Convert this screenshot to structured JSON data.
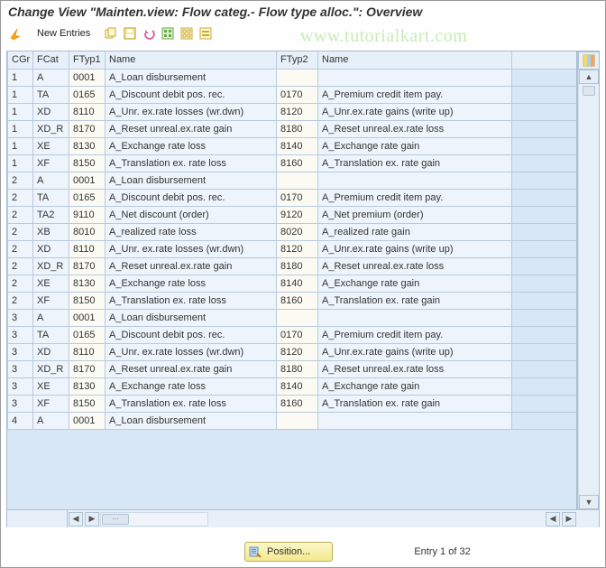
{
  "title": "Change View \"Mainten.view: Flow categ.- Flow type alloc.\": Overview",
  "watermark": "www.tutorialkart.com",
  "toolbar": {
    "new_entries": "New Entries"
  },
  "columns": {
    "cgr": "CGr",
    "fcat": "FCat",
    "ftyp1": "FTyp1",
    "name1": "Name",
    "ftyp2": "FTyp2",
    "name2": "Name"
  },
  "rows": [
    {
      "cgr": "1",
      "fcat": "A",
      "ftyp1": "0001",
      "name1": "A_Loan disbursement",
      "ftyp2": "",
      "name2": ""
    },
    {
      "cgr": "1",
      "fcat": "TA",
      "ftyp1": "0165",
      "name1": "A_Discount debit pos. rec.",
      "ftyp2": "0170",
      "name2": "A_Premium credit item pay."
    },
    {
      "cgr": "1",
      "fcat": "XD",
      "ftyp1": "8110",
      "name1": "A_Unr. ex.rate losses (wr.dwn)",
      "ftyp2": "8120",
      "name2": "A_Unr.ex.rate gains (write up)"
    },
    {
      "cgr": "1",
      "fcat": "XD_R",
      "ftyp1": "8170",
      "name1": "A_Reset unreal.ex.rate gain",
      "ftyp2": "8180",
      "name2": "A_Reset unreal.ex.rate loss"
    },
    {
      "cgr": "1",
      "fcat": "XE",
      "ftyp1": "8130",
      "name1": "A_Exchange rate loss",
      "ftyp2": "8140",
      "name2": "A_Exchange rate gain"
    },
    {
      "cgr": "1",
      "fcat": "XF",
      "ftyp1": "8150",
      "name1": "A_Translation ex. rate loss",
      "ftyp2": "8160",
      "name2": "A_Translation ex. rate gain"
    },
    {
      "cgr": "2",
      "fcat": "A",
      "ftyp1": "0001",
      "name1": "A_Loan disbursement",
      "ftyp2": "",
      "name2": ""
    },
    {
      "cgr": "2",
      "fcat": "TA",
      "ftyp1": "0165",
      "name1": "A_Discount debit pos. rec.",
      "ftyp2": "0170",
      "name2": "A_Premium credit item pay."
    },
    {
      "cgr": "2",
      "fcat": "TA2",
      "ftyp1": "9110",
      "name1": "A_Net discount (order)",
      "ftyp2": "9120",
      "name2": "A_Net premium (order)"
    },
    {
      "cgr": "2",
      "fcat": "XB",
      "ftyp1": "8010",
      "name1": "A_realized rate loss",
      "ftyp2": "8020",
      "name2": "A_realized rate gain"
    },
    {
      "cgr": "2",
      "fcat": "XD",
      "ftyp1": "8110",
      "name1": "A_Unr. ex.rate losses (wr.dwn)",
      "ftyp2": "8120",
      "name2": "A_Unr.ex.rate gains (write up)"
    },
    {
      "cgr": "2",
      "fcat": "XD_R",
      "ftyp1": "8170",
      "name1": "A_Reset unreal.ex.rate gain",
      "ftyp2": "8180",
      "name2": "A_Reset unreal.ex.rate loss"
    },
    {
      "cgr": "2",
      "fcat": "XE",
      "ftyp1": "8130",
      "name1": "A_Exchange rate loss",
      "ftyp2": "8140",
      "name2": "A_Exchange rate gain"
    },
    {
      "cgr": "2",
      "fcat": "XF",
      "ftyp1": "8150",
      "name1": "A_Translation ex. rate loss",
      "ftyp2": "8160",
      "name2": "A_Translation ex. rate gain"
    },
    {
      "cgr": "3",
      "fcat": "A",
      "ftyp1": "0001",
      "name1": "A_Loan disbursement",
      "ftyp2": "",
      "name2": ""
    },
    {
      "cgr": "3",
      "fcat": "TA",
      "ftyp1": "0165",
      "name1": "A_Discount debit pos. rec.",
      "ftyp2": "0170",
      "name2": "A_Premium credit item pay."
    },
    {
      "cgr": "3",
      "fcat": "XD",
      "ftyp1": "8110",
      "name1": "A_Unr. ex.rate losses (wr.dwn)",
      "ftyp2": "8120",
      "name2": "A_Unr.ex.rate gains (write up)"
    },
    {
      "cgr": "3",
      "fcat": "XD_R",
      "ftyp1": "8170",
      "name1": "A_Reset unreal.ex.rate gain",
      "ftyp2": "8180",
      "name2": "A_Reset unreal.ex.rate loss"
    },
    {
      "cgr": "3",
      "fcat": "XE",
      "ftyp1": "8130",
      "name1": "A_Exchange rate loss",
      "ftyp2": "8140",
      "name2": "A_Exchange rate gain"
    },
    {
      "cgr": "3",
      "fcat": "XF",
      "ftyp1": "8150",
      "name1": "A_Translation ex. rate loss",
      "ftyp2": "8160",
      "name2": "A_Translation ex. rate gain"
    },
    {
      "cgr": "4",
      "fcat": "A",
      "ftyp1": "0001",
      "name1": "A_Loan disbursement",
      "ftyp2": "",
      "name2": ""
    }
  ],
  "footer": {
    "position_label": "Position...",
    "entry_text": "Entry 1 of 32"
  }
}
